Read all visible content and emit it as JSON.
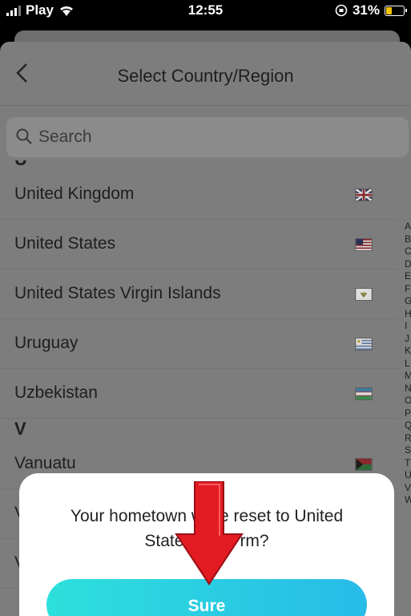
{
  "status_bar": {
    "carrier": "Play",
    "time": "12:55",
    "battery": "31%"
  },
  "header": {
    "title": "Select Country/Region"
  },
  "search": {
    "placeholder": "Search"
  },
  "list": {
    "cut_header": "U",
    "items": [
      {
        "label": "United Kingdom",
        "flag": "uk-flag"
      },
      {
        "label": "United States",
        "flag": "us-flag"
      },
      {
        "label": "United States Virgin Islands",
        "flag": "vi-flag"
      },
      {
        "label": "Uruguay",
        "flag": "uruguay-flag"
      },
      {
        "label": "Uzbekistan",
        "flag": "uzbekistan-flag"
      }
    ],
    "section_v": "V",
    "v_items": [
      {
        "label": "Vanuatu",
        "flag": "vanuatu-flag"
      },
      {
        "label": "V"
      },
      {
        "label": "V"
      }
    ]
  },
  "alphabet_index": [
    "A",
    "B",
    "C",
    "D",
    "E",
    "F",
    "G",
    "H",
    "I",
    "J",
    "K",
    "L",
    "M",
    "N",
    "O",
    "P",
    "Q",
    "R",
    "S",
    "T",
    "U",
    "V",
    "W"
  ],
  "dialog": {
    "message_line1": "Your hometown w",
    "message_line1_end": "e reset to United",
    "message_line2": "State",
    "message_line2_end": "rm?",
    "button": "Sure"
  },
  "colors": {
    "accent_start": "#2de0dc",
    "accent_end": "#28bbe8",
    "annotation_arrow": "#e31b23"
  }
}
